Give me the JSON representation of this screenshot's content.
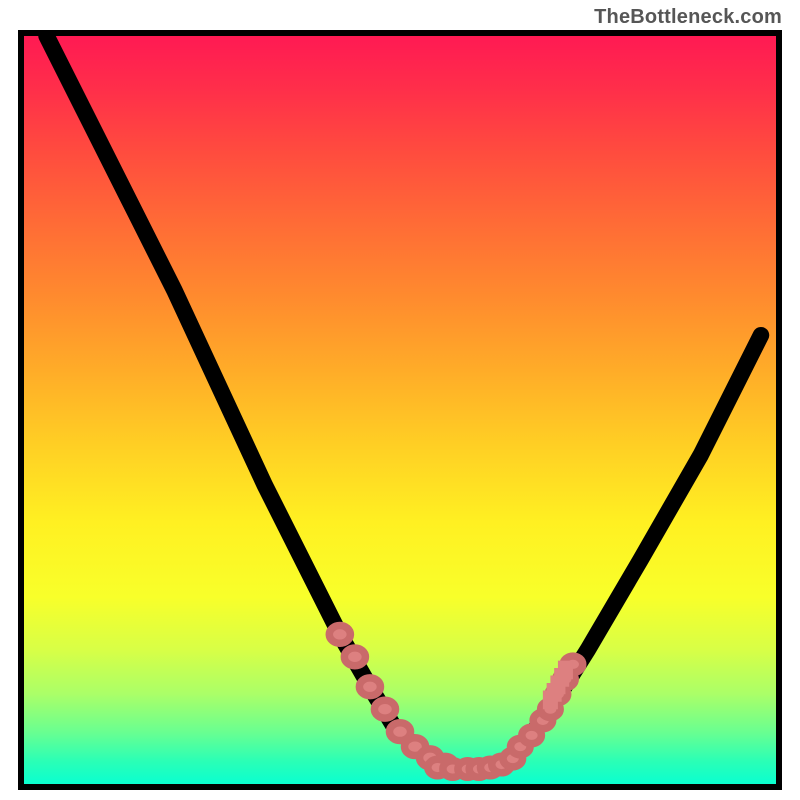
{
  "watermark": "TheBottleneck.com",
  "chart_data": {
    "type": "line",
    "title": "",
    "xlabel": "",
    "ylabel": "",
    "xlim": [
      0,
      100
    ],
    "ylim": [
      0,
      100
    ],
    "grid": false,
    "series": [
      {
        "name": "curve",
        "x": [
          3,
          8,
          14,
          20,
          26,
          32,
          38,
          42,
          46,
          49,
          52,
          55,
          58,
          61,
          64,
          67,
          70,
          75,
          82,
          90,
          98
        ],
        "y": [
          100,
          90,
          78,
          66,
          53,
          40,
          28,
          20,
          13,
          8,
          5,
          3,
          2,
          2,
          3,
          6,
          10,
          18,
          30,
          44,
          60
        ]
      }
    ],
    "markers_left": {
      "x": [
        42,
        44,
        46,
        48,
        50,
        52,
        54,
        56
      ],
      "y": [
        20,
        17,
        13,
        10,
        7,
        5,
        3.5,
        2.5
      ]
    },
    "markers_bottom": {
      "x": [
        55,
        57,
        59,
        60.5,
        62,
        63.5,
        65
      ],
      "y": [
        2.2,
        2.0,
        2.0,
        2.0,
        2.2,
        2.6,
        3.4
      ]
    },
    "markers_right": {
      "x": [
        66,
        67.5,
        69,
        70,
        71,
        72,
        73
      ],
      "y": [
        5,
        6.5,
        8.5,
        10,
        12,
        14,
        16
      ]
    },
    "ticks_right": {
      "x": [
        70,
        70.5,
        71,
        71.5,
        72
      ],
      "y_base": [
        10,
        11,
        12,
        13,
        14
      ],
      "len": 2.5
    }
  }
}
